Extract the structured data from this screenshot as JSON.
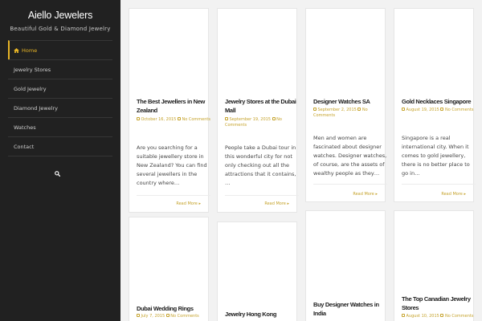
{
  "site": {
    "title": "Aiello Jewelers",
    "tagline": "Beautiful Gold & Diamond Jewelry"
  },
  "nav": {
    "items": [
      {
        "label": "Home",
        "active": true
      },
      {
        "label": "Jewelry Stores"
      },
      {
        "label": "Gold Jewelry"
      },
      {
        "label": "Diamond Jewelry"
      },
      {
        "label": "Watches"
      },
      {
        "label": "Contact"
      }
    ],
    "search_icon": "search-icon"
  },
  "posts": [
    {
      "title": "The Best Jewellers in New Zealand",
      "date": "October 16, 2015",
      "comments": "No Comments",
      "excerpt": "Are you searching for a suitable jewellery store in New Zealand? You can find several jewellers in the country where…",
      "read_more": "Read More"
    },
    {
      "title": "Jewelry Stores at the Dubai Mall",
      "date": "September 19, 2015",
      "comments": "No Comments",
      "excerpt": "People take a Dubai tour in this wonderful city for not only checking out all the attractions that it contains, …",
      "read_more": "Read More"
    },
    {
      "title": "Designer Watches SA",
      "date": "September 2, 2015",
      "comments": "No Comments",
      "excerpt": "Men and women are fascinated about designer watches. Designer watches, of course, are the assets of wealthy people as they…",
      "read_more": "Read More"
    },
    {
      "title": "Gold Necklaces Singapore",
      "date": "August 19, 2015",
      "comments": "No Comments",
      "excerpt": "Singapore is a real international city. When it comes to gold jewellery, there is no better place to go in…",
      "read_more": "Read More"
    },
    {
      "title": "Dubai Wedding Rings",
      "date": "July 7, 2015",
      "comments": "No Comments"
    },
    {
      "title": "Jewelry Hong Kong"
    },
    {
      "title": "Buy Designer Watches in India"
    },
    {
      "title": "The Top Canadian Jewelry Stores",
      "date": "August 10, 2015",
      "comments": "No Comments"
    }
  ]
}
